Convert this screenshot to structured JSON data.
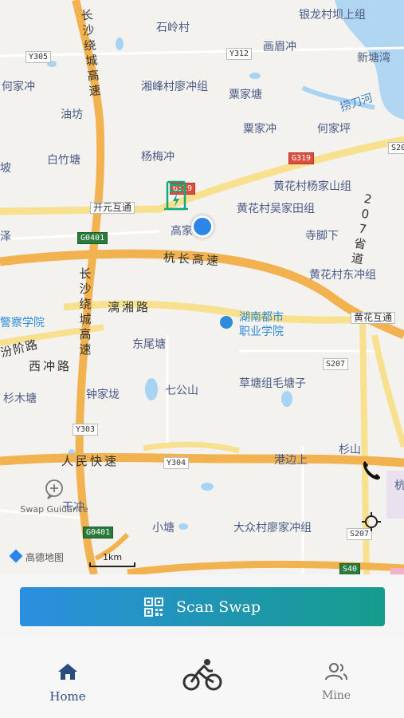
{
  "map": {
    "places": [
      {
        "id": "yinlong",
        "text": "银龙村坝上组"
      },
      {
        "id": "shiling",
        "text": "石岭村"
      },
      {
        "id": "huameichong",
        "text": "画眉冲"
      },
      {
        "id": "xintangwan",
        "text": "新塘湾"
      },
      {
        "id": "hejiachong",
        "text": "何家冲"
      },
      {
        "id": "xiangfeng",
        "text": "湘峰村廖冲组"
      },
      {
        "id": "lijiatang",
        "text": "粟家塘"
      },
      {
        "id": "laodaohe",
        "text": "捞刀河"
      },
      {
        "id": "youfang",
        "text": "油坊"
      },
      {
        "id": "lijiachong",
        "text": "粟家冲"
      },
      {
        "id": "hejiaping",
        "text": "何家坪"
      },
      {
        "id": "baizhutang",
        "text": "白竹塘"
      },
      {
        "id": "yangmeichong",
        "text": "杨梅冲"
      },
      {
        "id": "po",
        "text": "坡"
      },
      {
        "id": "huanghua_yang",
        "text": "黄花村杨家山组"
      },
      {
        "id": "huanghua_wu",
        "text": "黄花村吴家田组"
      },
      {
        "id": "gaojia",
        "text": "高家"
      },
      {
        "id": "sijiaoxia",
        "text": "寺脚下"
      },
      {
        "id": "huanghua_dong",
        "text": "黄花村东冲组"
      },
      {
        "id": "dongweitang",
        "text": "东尾塘"
      },
      {
        "id": "qigongshan",
        "text": "七公山"
      },
      {
        "id": "caotang",
        "text": "草塘组毛塘子"
      },
      {
        "id": "shanmutang",
        "text": "杉木塘"
      },
      {
        "id": "zhongjialong",
        "text": "钟家垅"
      },
      {
        "id": "shanshan",
        "text": "杉山"
      },
      {
        "id": "gangbianshang",
        "text": "港边上"
      },
      {
        "id": "ganchong",
        "text": "干冲"
      },
      {
        "id": "xiaotang",
        "text": "小塘"
      },
      {
        "id": "dazhong",
        "text": "大众村廖家冲组"
      },
      {
        "id": "xichong",
        "text": "西冲路"
      },
      {
        "id": "ze",
        "text": "泽"
      },
      {
        "id": "hang",
        "text": "杭"
      }
    ],
    "pois": [
      {
        "id": "police",
        "text": "警察学院"
      },
      {
        "id": "hunan_poi",
        "text": "湖南都市"
      },
      {
        "id": "hunan_poi2",
        "text": "职业学院"
      }
    ],
    "roads": [
      {
        "id": "hangchang",
        "text": "杭长高速"
      },
      {
        "id": "lixiang",
        "text": "漓湘路"
      },
      {
        "id": "renmin",
        "text": "人民快速"
      },
      {
        "id": "changsha_ring",
        "text": "长沙绕城高速"
      },
      {
        "id": "changsha_ring2",
        "text": "长沙绕城高速"
      },
      {
        "id": "s207_vert",
        "text": "207省道"
      },
      {
        "id": "fenqi",
        "text": "汾阶路"
      }
    ],
    "shields": [
      {
        "id": "y305",
        "text": "Y305"
      },
      {
        "id": "y312",
        "text": "Y312"
      },
      {
        "id": "g319",
        "text": "G319"
      },
      {
        "id": "g319b",
        "text": "G319"
      },
      {
        "id": "s20",
        "text": "S20"
      },
      {
        "id": "g0401",
        "text": "G0401"
      },
      {
        "id": "g0401b",
        "text": "G0401"
      },
      {
        "id": "y303",
        "text": "Y303"
      },
      {
        "id": "y304",
        "text": "Y304"
      },
      {
        "id": "s207",
        "text": "S207"
      },
      {
        "id": "s207b",
        "text": "S207"
      },
      {
        "id": "s40",
        "text": "S40"
      }
    ],
    "interchanges": [
      {
        "id": "kaiyuan",
        "text": "开元互通"
      },
      {
        "id": "huanghua_hutong",
        "text": "黄花互通"
      }
    ],
    "swap_guidance_label": "Swap Guidance",
    "scale_label": "1km",
    "attribution": "高德地图"
  },
  "scan_button_label": "Scan Swap",
  "tabs": [
    {
      "id": "home",
      "label": "Home",
      "icon": "home-icon",
      "active": true
    },
    {
      "id": "ride",
      "label": "",
      "icon": "bicycle-icon",
      "active": false
    },
    {
      "id": "mine",
      "label": "Mine",
      "icon": "users-icon",
      "active": false
    }
  ],
  "colors": {
    "accent": "#2a4d7f",
    "gradient_start": "#2b8fe0",
    "gradient_end": "#169c8c",
    "highway": "#f2b24f",
    "road": "#f7e08e",
    "water": "#a9d3f2"
  }
}
